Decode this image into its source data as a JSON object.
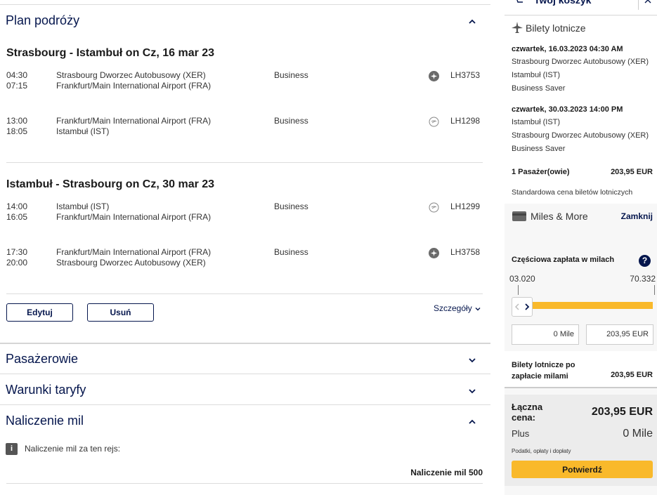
{
  "plan": {
    "title": "Plan podróży",
    "outbound": {
      "title": "Strasbourg - Istambuł on Cz, 16 mar 23",
      "segments": [
        {
          "dep": "04:30",
          "arr": "07:15",
          "from": "Strasbourg Dworzec Autobusowy (XER)",
          "to": "Frankfurt/Main International Airport (FRA)",
          "cabin": "Business",
          "flight": "LH3753",
          "icon": "bus-plane-icon"
        },
        {
          "dep": "13:00",
          "arr": "18:05",
          "from": "Frankfurt/Main International Airport (FRA)",
          "to": "Istambuł (IST)",
          "cabin": "Business",
          "flight": "LH1298",
          "icon": "lufthansa-crane-icon"
        }
      ]
    },
    "inbound": {
      "title": "Istambuł - Strasbourg on Cz, 30 mar 23",
      "segments": [
        {
          "dep": "14:00",
          "arr": "16:05",
          "from": "Istambuł (IST)",
          "to": "Frankfurt/Main International Airport (FRA)",
          "cabin": "Business",
          "flight": "LH1299",
          "icon": "lufthansa-crane-icon"
        },
        {
          "dep": "17:30",
          "arr": "20:00",
          "from": "Frankfurt/Main International Airport (FRA)",
          "to": "Strasbourg Dworzec Autobusowy (XER)",
          "cabin": "Business",
          "flight": "LH3758",
          "icon": "bus-plane-icon"
        }
      ]
    },
    "edit_label": "Edytuj",
    "remove_label": "Usuń",
    "details_label": "Szczegóły"
  },
  "sections": {
    "passengers": "Pasażerowie",
    "fare_rules": "Warunki taryfy",
    "miles_accrual": "Naliczenie mil",
    "miles_accrual_info": "Naliczenie mil za ten rejs:",
    "miles_accrual_total": "Naliczenie mil 500"
  },
  "cart": {
    "title": "Twój koszyk",
    "tickets_label": "Bilety lotnicze",
    "outbound": {
      "date": "czwartek, 16.03.2023 04:30 AM",
      "from": "Strasbourg Dworzec Autobusowy (XER)",
      "to": "Istambuł (IST)",
      "fare": "Business Saver"
    },
    "inbound": {
      "date": "czwartek, 30.03.2023 14:00 PM",
      "from": "Istambuł (IST)",
      "to": "Strasbourg Dworzec Autobusowy (XER)",
      "fare": "Business Saver"
    },
    "passengers": "1 Pasażer(owie)",
    "passengers_price": "203,95 EUR",
    "standard_note": "Standardowa cena biletów lotniczych",
    "miles_more": "Miles & More",
    "close_label": "Zamknij",
    "partial_label": "Częściowa zapłata w milach",
    "slider_min": "03.020",
    "slider_max": "70.332",
    "slider_level": 0,
    "miles_input": "0 Mile",
    "eur_input": "203,95 EUR",
    "after_miles_label": "Bilety lotnicze po zapłacie milami",
    "after_miles_price": "203,95 EUR",
    "total_label": "Łączna cena:",
    "total_price": "203,95 EUR",
    "plus_label": "Plus",
    "plus_miles": "0 Mile",
    "taxes_note": "Podatki, opłaty i dopłaty",
    "confirm_label": "Potwierdź"
  },
  "colors": {
    "navy": "#05164d",
    "yellow": "#f9b92b",
    "gray_panel": "#f1f1f1"
  }
}
